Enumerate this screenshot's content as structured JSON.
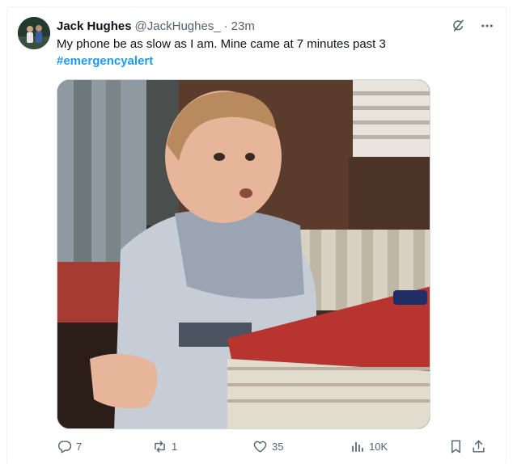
{
  "tweet": {
    "author_name": "Jack Hughes",
    "author_handle": "@JackHughes_",
    "separator": "·",
    "time": "23m",
    "text": "My phone be as slow as I am. Mine came at 7 minutes past 3",
    "hashtag": "#emergencyalert",
    "media_description_icon": "photo"
  },
  "actions": {
    "replies": "7",
    "reposts": "1",
    "likes": "35",
    "views": "10K"
  },
  "icons": {
    "grok": "grok-icon",
    "more": "more-icon",
    "reply": "reply-icon",
    "repost": "repost-icon",
    "like": "heart-icon",
    "views": "views-icon",
    "bookmark": "bookmark-icon",
    "share": "share-icon"
  },
  "colors": {
    "link": "#1d9bf0",
    "secondary_text": "#536471",
    "primary_text": "#0f1419"
  }
}
